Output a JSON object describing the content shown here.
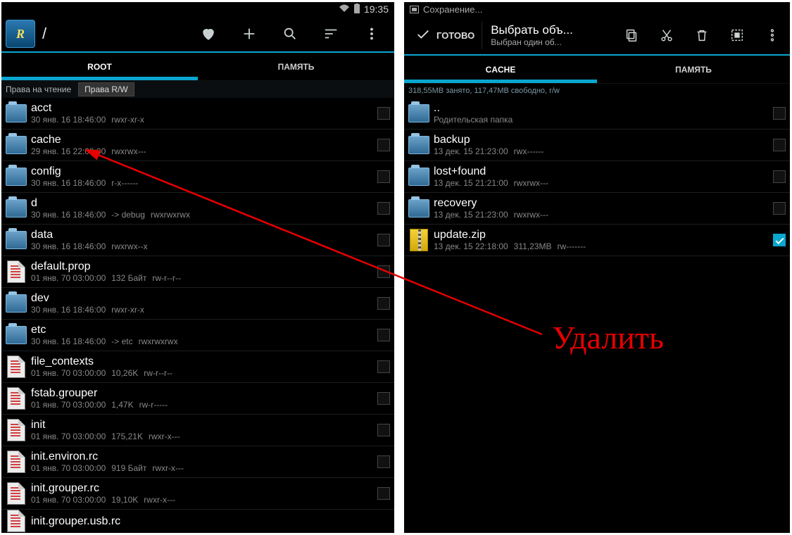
{
  "statusbar": {
    "time": "19:35"
  },
  "saving_label": "Сохранение...",
  "left_toolbar": {
    "path": "/",
    "favorite": "favorite-icon",
    "add": "add-icon",
    "search": "search-icon",
    "sort": "sort-icon",
    "menu": "menu-icon"
  },
  "left_tabs": {
    "root": "ROOT",
    "memory": "ПАМЯТЬ"
  },
  "permbar": {
    "read": "Права на чтение",
    "rw": "Права R/W"
  },
  "left_files": [
    {
      "name": "acct",
      "date": "30 янв. 16 18:46:00",
      "perm": "rwxr-xr-x",
      "type": "folder"
    },
    {
      "name": "cache",
      "date": "29 янв. 16 22:09:00",
      "perm": "rwxrwx---",
      "type": "folder"
    },
    {
      "name": "config",
      "date": "30 янв. 16 18:46:00",
      "perm": "r-x------",
      "type": "folder"
    },
    {
      "name": "d",
      "date": "30 янв. 16 18:46:00",
      "link": "-> debug",
      "perm": "rwxrwxrwx",
      "type": "folder"
    },
    {
      "name": "data",
      "date": "30 янв. 16 18:46:00",
      "perm": "rwxrwx--x",
      "type": "folder"
    },
    {
      "name": "default.prop",
      "date": "01 янв. 70 03:00:00",
      "size": "132 Байт",
      "perm": "rw-r--r--",
      "type": "file"
    },
    {
      "name": "dev",
      "date": "30 янв. 16 18:46:00",
      "perm": "rwxr-xr-x",
      "type": "folder"
    },
    {
      "name": "etc",
      "date": "30 янв. 16 18:46:00",
      "link": "-> etc",
      "perm": "rwxrwxrwx",
      "type": "folder"
    },
    {
      "name": "file_contexts",
      "date": "01 янв. 70 03:00:00",
      "size": "10,26K",
      "perm": "rw-r--r--",
      "type": "file"
    },
    {
      "name": "fstab.grouper",
      "date": "01 янв. 70 03:00:00",
      "size": "1,47K",
      "perm": "rw-r-----",
      "type": "file"
    },
    {
      "name": "init",
      "date": "01 янв. 70 03:00:00",
      "size": "175,21K",
      "perm": "rwxr-x---",
      "type": "file"
    },
    {
      "name": "init.environ.rc",
      "date": "01 янв. 70 03:00:00",
      "size": "919 Байт",
      "perm": "rwxr-x---",
      "type": "file"
    },
    {
      "name": "init.grouper.rc",
      "date": "01 янв. 70 03:00:00",
      "size": "19,10K",
      "perm": "rwxr-x---",
      "type": "file"
    },
    {
      "name": "init.grouper.usb.rc",
      "date": "",
      "size": "",
      "perm": "",
      "type": "file"
    }
  ],
  "actionbar": {
    "done": "ГОТОВО",
    "title": "Выбрать объ...",
    "subtitle": "Выбран один об..."
  },
  "right_tabs": {
    "cache": "CACHE",
    "memory": "ПАМЯТЬ"
  },
  "storage_info": "318,55MB занято, 117,47MB свободно, r/w",
  "right_files": [
    {
      "name": "..",
      "sub": "Родительская папка",
      "type": "folder",
      "checked": false
    },
    {
      "name": "backup",
      "date": "13 дек. 15 21:23:00",
      "perm": "rwx------",
      "type": "folder",
      "checked": false
    },
    {
      "name": "lost+found",
      "date": "13 дек. 15 21:21:00",
      "perm": "rwxrwx---",
      "type": "folder",
      "checked": false
    },
    {
      "name": "recovery",
      "date": "13 дек. 15 21:23:00",
      "perm": "rwxrwx---",
      "type": "folder",
      "checked": false
    },
    {
      "name": "update.zip",
      "date": "13 дек. 15 22:18:00",
      "size": "311,23MB",
      "perm": "rw-------",
      "type": "zip",
      "checked": true
    }
  ],
  "annotation": "Удалить"
}
